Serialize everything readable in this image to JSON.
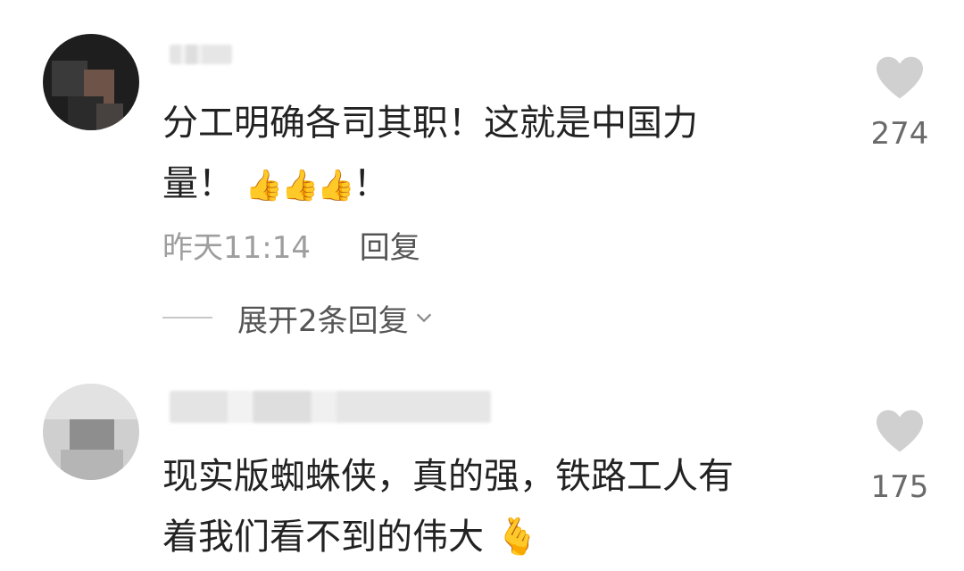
{
  "comments": [
    {
      "text_line1": "分工明确各司其职！这就是中国力",
      "text_line2": "量！",
      "emoji": "👍👍👍",
      "text_tail": "！",
      "time": "昨天11:14",
      "reply_label": "回复",
      "expand_label": "展开2条回复",
      "likes": "274"
    },
    {
      "text_line1": "现实版蜘蛛侠，真的强，铁路工人有",
      "text_line2": "着我们看不到的伟大",
      "emoji": "🫰",
      "likes": "175"
    }
  ],
  "colors": {
    "text": "#222222",
    "meta": "#9e9e9e",
    "heart": "#d0d0d0"
  }
}
